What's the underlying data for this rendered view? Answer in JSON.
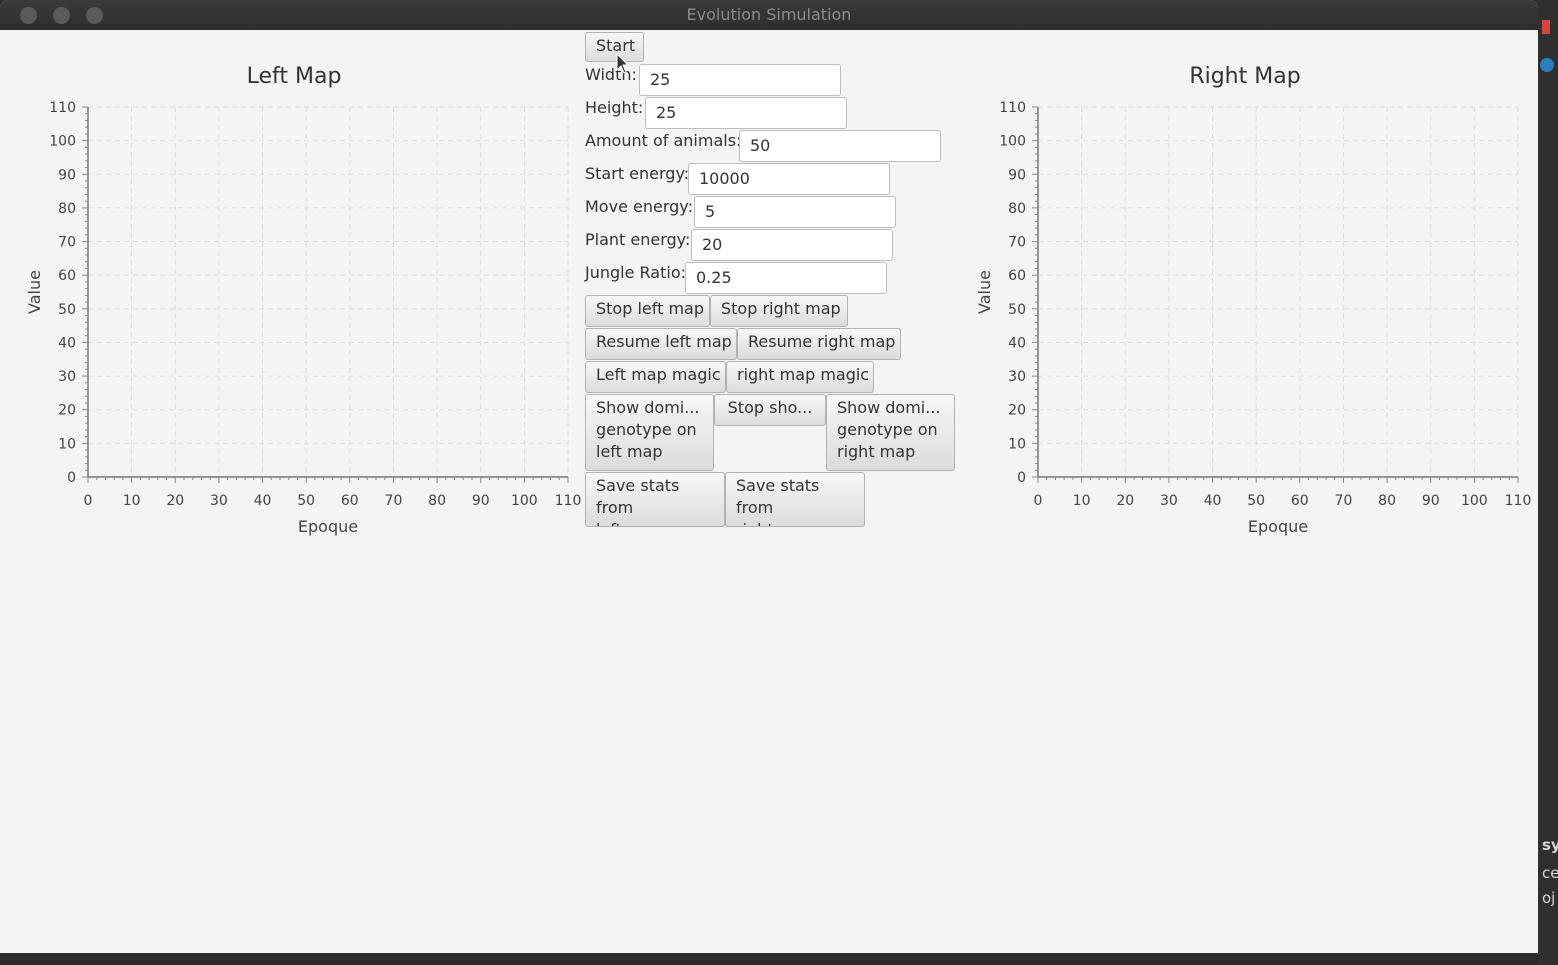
{
  "window": {
    "title": "Evolution Simulation"
  },
  "controls": {
    "start_label": "Start",
    "fields": [
      {
        "label": "Width:",
        "value": "25"
      },
      {
        "label": "Height:",
        "value": "25"
      },
      {
        "label": "Amount of animals:",
        "value": "50"
      },
      {
        "label": "Start energy:",
        "value": "10000"
      },
      {
        "label": "Move energy:",
        "value": "5"
      },
      {
        "label": "Plant energy:",
        "value": "20"
      },
      {
        "label": "Jungle Ratio:",
        "value": "0.25"
      }
    ],
    "stop_left": "Stop left map",
    "stop_right": "Stop right map",
    "resume_left": "Resume left map",
    "resume_right": "Resume right map",
    "magic_left": "Left map magic",
    "magic_right": "right map magic",
    "show_dom_left": "Show domi...\ngenotype on\nleft map",
    "stop_show": "Stop sho...",
    "show_dom_right": "Show domi...\ngenotype on\nright map",
    "save_left": "Save stats from\nleft map",
    "save_right": "Save stats from\nright map"
  },
  "chart_data": [
    {
      "type": "line",
      "title": "Left Map",
      "xlabel": "Epoque",
      "ylabel": "Value",
      "xlim": [
        0,
        110
      ],
      "ylim": [
        0,
        110
      ],
      "x_ticks": [
        0,
        10,
        20,
        30,
        40,
        50,
        60,
        70,
        80,
        90,
        100,
        110
      ],
      "y_ticks": [
        0,
        10,
        20,
        30,
        40,
        50,
        60,
        70,
        80,
        90,
        100,
        110
      ],
      "grid": true,
      "series": []
    },
    {
      "type": "line",
      "title": "Right Map",
      "xlabel": "Epoque",
      "ylabel": "Value",
      "xlim": [
        0,
        110
      ],
      "ylim": [
        0,
        110
      ],
      "x_ticks": [
        0,
        10,
        20,
        30,
        40,
        50,
        60,
        70,
        80,
        90,
        100,
        110
      ],
      "y_ticks": [
        0,
        10,
        20,
        30,
        40,
        50,
        60,
        70,
        80,
        90,
        100,
        110
      ],
      "grid": true,
      "series": []
    }
  ],
  "background_snippets": [
    "sy",
    "ce",
    "oj"
  ],
  "colors": {
    "window_bg": "#f4f4f4",
    "titlebar": "#323232",
    "button_border": "#b2b2b2"
  }
}
